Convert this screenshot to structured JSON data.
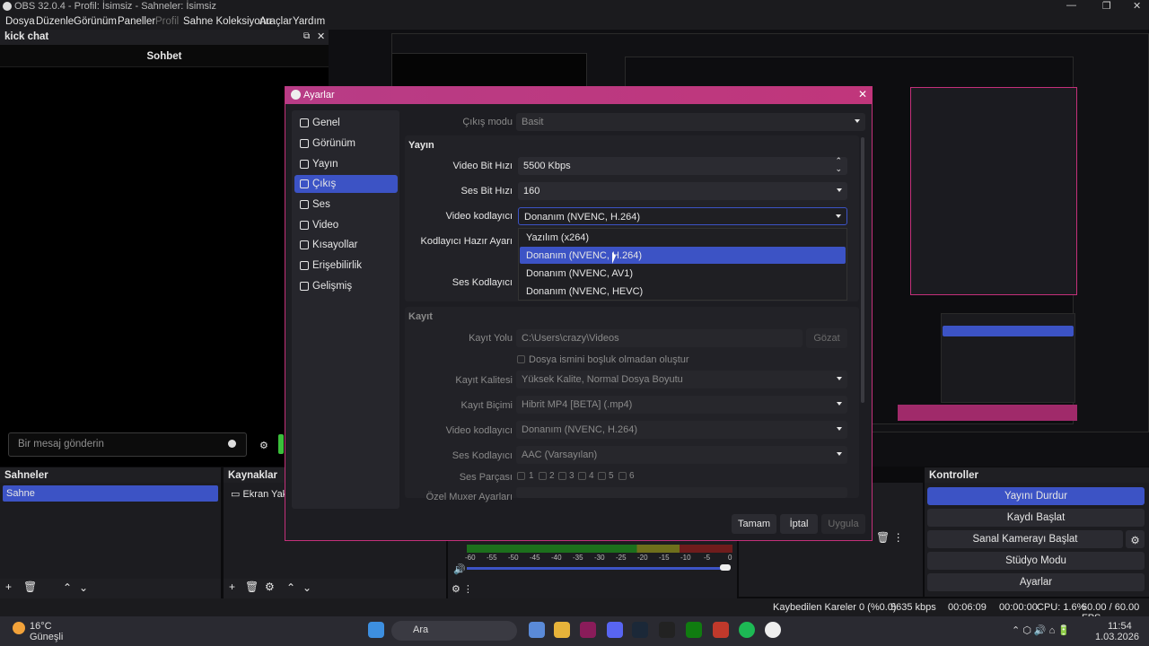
{
  "window": {
    "title": "OBS 32.0.4 - Profil: İsimsiz - Sahneler: İsimsiz"
  },
  "menu": [
    "Dosya",
    "Düzenle",
    "Görünüm",
    "Paneller",
    "Profil",
    "Sahne Koleksiyonu",
    "Araçlar",
    "Yardım"
  ],
  "chat": {
    "title": "kick chat",
    "header": "Sohbet",
    "placeholder": "Bir mesaj gönderin"
  },
  "scenes": {
    "title": "Sahneler",
    "items": [
      "Sahne"
    ]
  },
  "sources": {
    "title": "Kaynaklar",
    "items": [
      "Ekran Yakal"
    ]
  },
  "controls": {
    "title": "Kontroller",
    "stop_stream": "Yayını Durdur",
    "start_record": "Kaydı Başlat",
    "virtual_cam": "Sanal Kamerayı Başlat",
    "studio_mode": "Stüdyo Modu",
    "settings": "Ayarlar"
  },
  "status": {
    "dropped": "Kaybedilen Kareler 0 (%0.0)",
    "bitrate": "5635 kbps",
    "stream_time": "00:06:09",
    "rec_time": "00:00:00",
    "cpu": "CPU: 1.6%",
    "fps": "60.00 / 60.00 FPS"
  },
  "taskbar": {
    "weather_temp": "16°C",
    "weather_desc": "Güneşli",
    "search": "Ara",
    "time": "11:54",
    "date": "1.03.2026"
  },
  "dialog": {
    "title": "Ayarlar",
    "sidebar": [
      "Genel",
      "Görünüm",
      "Yayın",
      "Çıkış",
      "Ses",
      "Video",
      "Kısayollar",
      "Erişebilirlik",
      "Gelişmiş"
    ],
    "selected": "Çıkış",
    "output_mode_label": "Çıkış modu",
    "output_mode": "Basit",
    "stream_section": "Yayın",
    "video_bitrate_label": "Video Bit Hızı",
    "video_bitrate": "5500 Kbps",
    "audio_bitrate_label": "Ses Bit Hızı",
    "audio_bitrate": "160",
    "video_encoder_label": "Video kodlayıcı",
    "video_encoder": "Donanım (NVENC, H.264)",
    "encoder_preset_label": "Kodlayıcı Hazır Ayarı",
    "audio_encoder_label": "Ses Kodlayıcı",
    "dropdown_options": [
      "Yazılım (x264)",
      "Donanım (NVENC, H.264)",
      "Donanım (NVENC, AV1)",
      "Donanım (NVENC, HEVC)"
    ],
    "dropdown_highlight": 1,
    "record_section": "Kayıt",
    "record_path_label": "Kayıt Yolu",
    "record_path": "C:\\Users\\crazy\\Videos",
    "browse": "Gözat",
    "no_space_label": "Dosya ismini boşluk olmadan oluştur",
    "record_quality_label": "Kayıt Kalitesi",
    "record_quality": "Yüksek Kalite, Normal Dosya Boyutu",
    "record_format_label": "Kayıt Biçimi",
    "record_format": "Hibrit MP4 [BETA] (.mp4)",
    "rec_video_encoder_label": "Video kodlayıcı",
    "rec_video_encoder": "Donanım (NVENC, H.264)",
    "rec_audio_encoder_label": "Ses Kodlayıcı",
    "rec_audio_encoder": "AAC (Varsayılan)",
    "audio_track_label": "Ses Parçası",
    "audio_tracks": [
      "1",
      "2",
      "3",
      "4",
      "5",
      "6"
    ],
    "muxer_label": "Özel Muxer Ayarları",
    "ok": "Tamam",
    "cancel": "İptal",
    "apply": "Uygula"
  },
  "meter_ticks": [
    "-60",
    "-55",
    "-50",
    "-45",
    "-40",
    "-35",
    "-30",
    "-25",
    "-20",
    "-15",
    "-10",
    "-5",
    "0"
  ]
}
